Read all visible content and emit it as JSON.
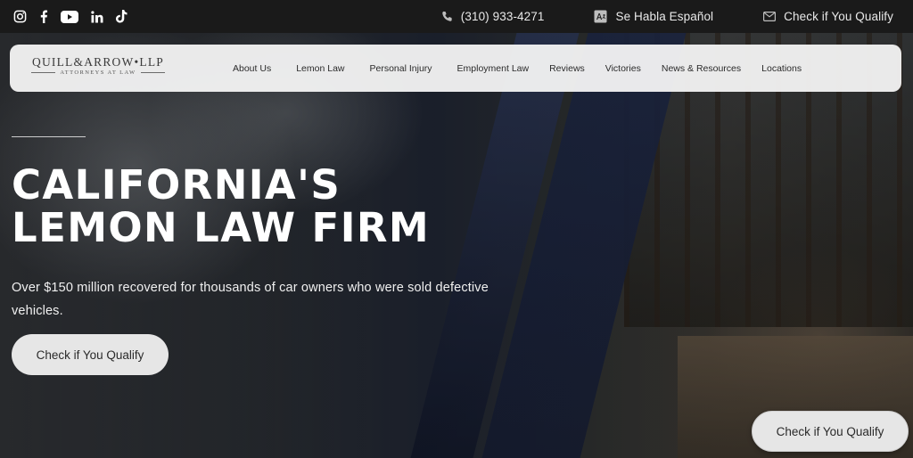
{
  "topbar": {
    "social": [
      {
        "icon": "instagram-icon"
      },
      {
        "icon": "facebook-icon"
      },
      {
        "icon": "youtube-icon"
      },
      {
        "icon": "linkedin-icon"
      },
      {
        "icon": "tiktok-icon"
      }
    ],
    "phone": "(310) 933-4271",
    "spanish": "Se Habla Español",
    "qualify": "Check if You Qualify"
  },
  "nav": {
    "logo_main": "QUILL&ARROW•LLP",
    "logo_sub": "ATTORNEYS AT LAW",
    "links": [
      "About Us",
      "Lemon Law",
      "Personal Injury",
      "Employment Law",
      "Reviews",
      "Victories",
      "News & Resources",
      "Locations"
    ]
  },
  "hero": {
    "title_line1": "CALIFORNIA'S",
    "title_line2": "LEMON LAW FIRM",
    "subtitle": "Over $150 million recovered for thousands of car owners who were sold defective vehicles.",
    "cta": "Check if You Qualify"
  },
  "floating_cta": "Check if You Qualify",
  "colors": {
    "topbar": "#1a1a1a",
    "nav_card": "#f4f4f4",
    "button": "#e6e6e6",
    "text_light": "#ffffff"
  }
}
